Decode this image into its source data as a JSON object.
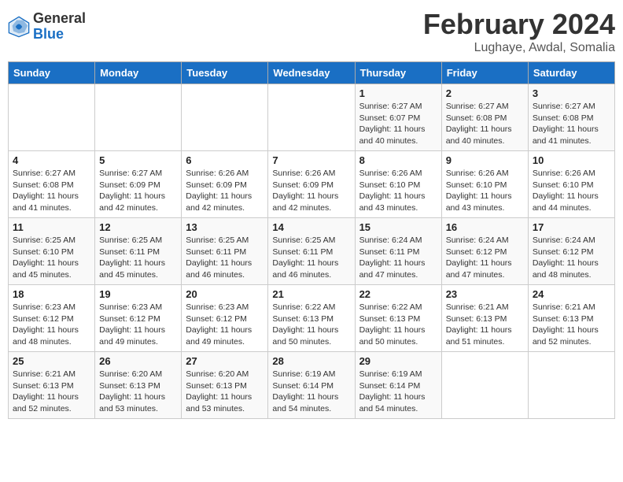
{
  "header": {
    "logo_general": "General",
    "logo_blue": "Blue",
    "month_title": "February 2024",
    "location": "Lughaye, Awdal, Somalia"
  },
  "days_of_week": [
    "Sunday",
    "Monday",
    "Tuesday",
    "Wednesday",
    "Thursday",
    "Friday",
    "Saturday"
  ],
  "weeks": [
    [
      {
        "day": "",
        "info": ""
      },
      {
        "day": "",
        "info": ""
      },
      {
        "day": "",
        "info": ""
      },
      {
        "day": "",
        "info": ""
      },
      {
        "day": "1",
        "info": "Sunrise: 6:27 AM\nSunset: 6:07 PM\nDaylight: 11 hours\nand 40 minutes."
      },
      {
        "day": "2",
        "info": "Sunrise: 6:27 AM\nSunset: 6:08 PM\nDaylight: 11 hours\nand 40 minutes."
      },
      {
        "day": "3",
        "info": "Sunrise: 6:27 AM\nSunset: 6:08 PM\nDaylight: 11 hours\nand 41 minutes."
      }
    ],
    [
      {
        "day": "4",
        "info": "Sunrise: 6:27 AM\nSunset: 6:08 PM\nDaylight: 11 hours\nand 41 minutes."
      },
      {
        "day": "5",
        "info": "Sunrise: 6:27 AM\nSunset: 6:09 PM\nDaylight: 11 hours\nand 42 minutes."
      },
      {
        "day": "6",
        "info": "Sunrise: 6:26 AM\nSunset: 6:09 PM\nDaylight: 11 hours\nand 42 minutes."
      },
      {
        "day": "7",
        "info": "Sunrise: 6:26 AM\nSunset: 6:09 PM\nDaylight: 11 hours\nand 42 minutes."
      },
      {
        "day": "8",
        "info": "Sunrise: 6:26 AM\nSunset: 6:10 PM\nDaylight: 11 hours\nand 43 minutes."
      },
      {
        "day": "9",
        "info": "Sunrise: 6:26 AM\nSunset: 6:10 PM\nDaylight: 11 hours\nand 43 minutes."
      },
      {
        "day": "10",
        "info": "Sunrise: 6:26 AM\nSunset: 6:10 PM\nDaylight: 11 hours\nand 44 minutes."
      }
    ],
    [
      {
        "day": "11",
        "info": "Sunrise: 6:25 AM\nSunset: 6:10 PM\nDaylight: 11 hours\nand 45 minutes."
      },
      {
        "day": "12",
        "info": "Sunrise: 6:25 AM\nSunset: 6:11 PM\nDaylight: 11 hours\nand 45 minutes."
      },
      {
        "day": "13",
        "info": "Sunrise: 6:25 AM\nSunset: 6:11 PM\nDaylight: 11 hours\nand 46 minutes."
      },
      {
        "day": "14",
        "info": "Sunrise: 6:25 AM\nSunset: 6:11 PM\nDaylight: 11 hours\nand 46 minutes."
      },
      {
        "day": "15",
        "info": "Sunrise: 6:24 AM\nSunset: 6:11 PM\nDaylight: 11 hours\nand 47 minutes."
      },
      {
        "day": "16",
        "info": "Sunrise: 6:24 AM\nSunset: 6:12 PM\nDaylight: 11 hours\nand 47 minutes."
      },
      {
        "day": "17",
        "info": "Sunrise: 6:24 AM\nSunset: 6:12 PM\nDaylight: 11 hours\nand 48 minutes."
      }
    ],
    [
      {
        "day": "18",
        "info": "Sunrise: 6:23 AM\nSunset: 6:12 PM\nDaylight: 11 hours\nand 48 minutes."
      },
      {
        "day": "19",
        "info": "Sunrise: 6:23 AM\nSunset: 6:12 PM\nDaylight: 11 hours\nand 49 minutes."
      },
      {
        "day": "20",
        "info": "Sunrise: 6:23 AM\nSunset: 6:12 PM\nDaylight: 11 hours\nand 49 minutes."
      },
      {
        "day": "21",
        "info": "Sunrise: 6:22 AM\nSunset: 6:13 PM\nDaylight: 11 hours\nand 50 minutes."
      },
      {
        "day": "22",
        "info": "Sunrise: 6:22 AM\nSunset: 6:13 PM\nDaylight: 11 hours\nand 50 minutes."
      },
      {
        "day": "23",
        "info": "Sunrise: 6:21 AM\nSunset: 6:13 PM\nDaylight: 11 hours\nand 51 minutes."
      },
      {
        "day": "24",
        "info": "Sunrise: 6:21 AM\nSunset: 6:13 PM\nDaylight: 11 hours\nand 52 minutes."
      }
    ],
    [
      {
        "day": "25",
        "info": "Sunrise: 6:21 AM\nSunset: 6:13 PM\nDaylight: 11 hours\nand 52 minutes."
      },
      {
        "day": "26",
        "info": "Sunrise: 6:20 AM\nSunset: 6:13 PM\nDaylight: 11 hours\nand 53 minutes."
      },
      {
        "day": "27",
        "info": "Sunrise: 6:20 AM\nSunset: 6:13 PM\nDaylight: 11 hours\nand 53 minutes."
      },
      {
        "day": "28",
        "info": "Sunrise: 6:19 AM\nSunset: 6:14 PM\nDaylight: 11 hours\nand 54 minutes."
      },
      {
        "day": "29",
        "info": "Sunrise: 6:19 AM\nSunset: 6:14 PM\nDaylight: 11 hours\nand 54 minutes."
      },
      {
        "day": "",
        "info": ""
      },
      {
        "day": "",
        "info": ""
      }
    ]
  ]
}
